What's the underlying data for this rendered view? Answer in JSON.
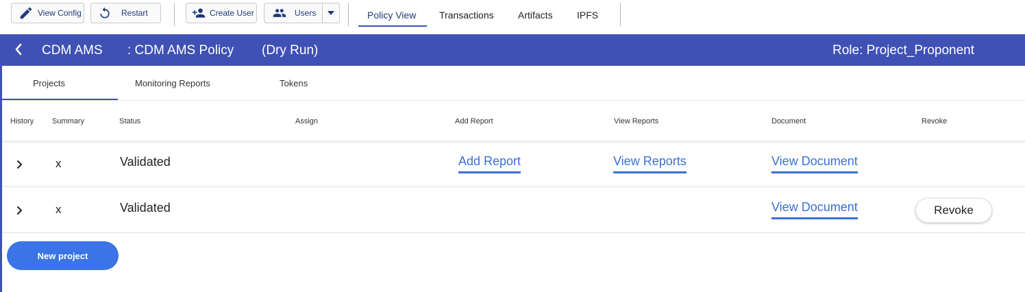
{
  "toolbar": {
    "view_config": "View Config",
    "restart": "Restart",
    "create_user": "Create User",
    "users": "Users"
  },
  "nav_tabs": [
    {
      "label": "Policy View",
      "active": true
    },
    {
      "label": "Transactions",
      "active": false
    },
    {
      "label": "Artifacts",
      "active": false
    },
    {
      "label": "IPFS",
      "active": false
    }
  ],
  "header": {
    "back_icon": "chevron-left-icon",
    "policy_group": "CDM AMS",
    "policy_name": ": CDM AMS Policy",
    "mode": "(Dry Run)",
    "role": "Role: Project_Proponent"
  },
  "sub_tabs": [
    {
      "label": "Projects",
      "active": true
    },
    {
      "label": "Monitoring Reports",
      "active": false
    },
    {
      "label": "Tokens",
      "active": false
    }
  ],
  "table": {
    "columns": [
      "History",
      "Summary",
      "Status",
      "Assign",
      "Add Report",
      "View Reports",
      "Document",
      "Revoke"
    ],
    "rows": [
      {
        "summary": "x",
        "status": "Validated",
        "add_report": "Add Report",
        "view_reports": "View Reports",
        "document": "View Document",
        "revoke": ""
      },
      {
        "summary": "x",
        "status": "Validated",
        "add_report": "",
        "view_reports": "",
        "document": "View Document",
        "revoke": "Revoke"
      }
    ]
  },
  "actions": {
    "new_project": "New project"
  },
  "colors": {
    "primary": "#3f51b5",
    "link": "#3b6fd1",
    "button": "#3b74e6"
  }
}
